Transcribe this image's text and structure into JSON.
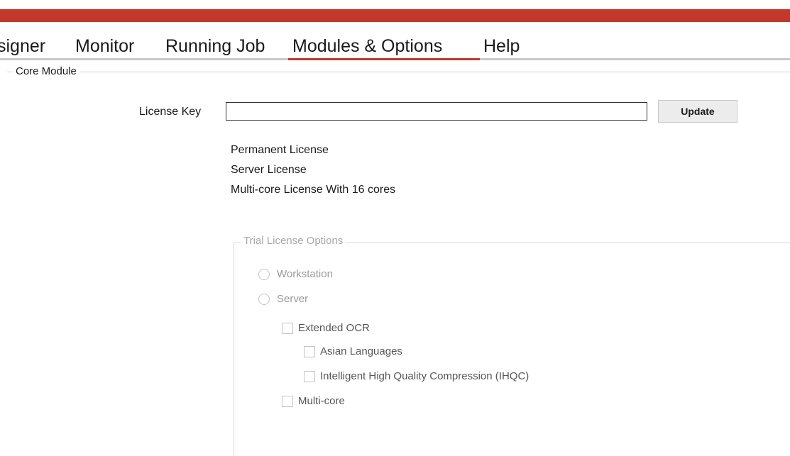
{
  "app": {
    "accent_color": "#c0392b"
  },
  "tabs": [
    {
      "label": "signer"
    },
    {
      "label": "Monitor"
    },
    {
      "label": "Running Job"
    },
    {
      "label": "Modules & Options"
    },
    {
      "label": "Help"
    }
  ],
  "active_tab": "Modules & Options",
  "core_module": {
    "legend": "Core Module",
    "license_key_label": "License Key",
    "license_key_value": "",
    "update_label": "Update",
    "license_info": [
      "Permanent License",
      "Server License",
      "Multi-core License With 16 cores"
    ]
  },
  "trial_options": {
    "legend": "Trial License Options",
    "radios": [
      {
        "label": "Workstation",
        "selected": false
      },
      {
        "label": "Server",
        "selected": false
      }
    ],
    "checkboxes": {
      "extended_ocr": {
        "label": "Extended OCR",
        "checked": false
      },
      "asian_languages": {
        "label": "Asian Languages",
        "checked": false
      },
      "ihqc": {
        "label": "Intelligent High Quality Compression (IHQC)",
        "checked": false
      },
      "multi_core": {
        "label": "Multi-core",
        "checked": false
      }
    }
  }
}
